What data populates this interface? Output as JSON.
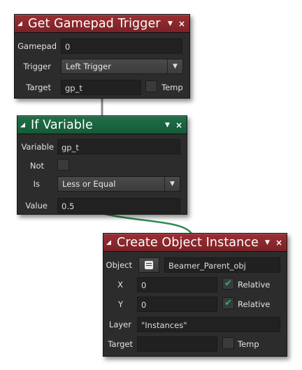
{
  "colors": {
    "red_header": "#8a282c",
    "green_header": "#1a6440",
    "body": "#2c2c2c",
    "field": "#212121",
    "check": "#2fb168"
  },
  "gamepad_node": {
    "title": "Get Gamepad Trigger",
    "gamepad_label": "Gamepad",
    "gamepad_value": "0",
    "trigger_label": "Trigger",
    "trigger_value": "Left Trigger",
    "target_label": "Target",
    "target_value": "gp_t",
    "temp_label": "Temp",
    "temp_checked": false
  },
  "if_node": {
    "title": "If Variable",
    "variable_label": "Variable",
    "variable_value": "gp_t",
    "not_label": "Not",
    "not_checked": false,
    "is_label": "Is",
    "is_value": "Less or Equal",
    "value_label": "Value",
    "value_value": "0.5"
  },
  "create_node": {
    "title": "Create Object Instance",
    "object_label": "Object",
    "object_value": "Beamer_Parent_obj",
    "x_label": "X",
    "x_value": "0",
    "x_relative_label": "Relative",
    "x_relative_checked": true,
    "y_label": "Y",
    "y_value": "0",
    "y_relative_label": "Relative",
    "y_relative_checked": true,
    "layer_label": "Layer",
    "layer_value": "\"Instances\"",
    "target_label": "Target",
    "target_value": "",
    "temp_label": "Temp",
    "temp_checked": false
  },
  "icons": {
    "collapse": "collapse-triangle-icon",
    "menu": "menu-arrow-icon",
    "close": "close-icon",
    "dropdown": "chevron-down-icon",
    "check": "checkmark-icon",
    "object": "object-picker-icon"
  }
}
